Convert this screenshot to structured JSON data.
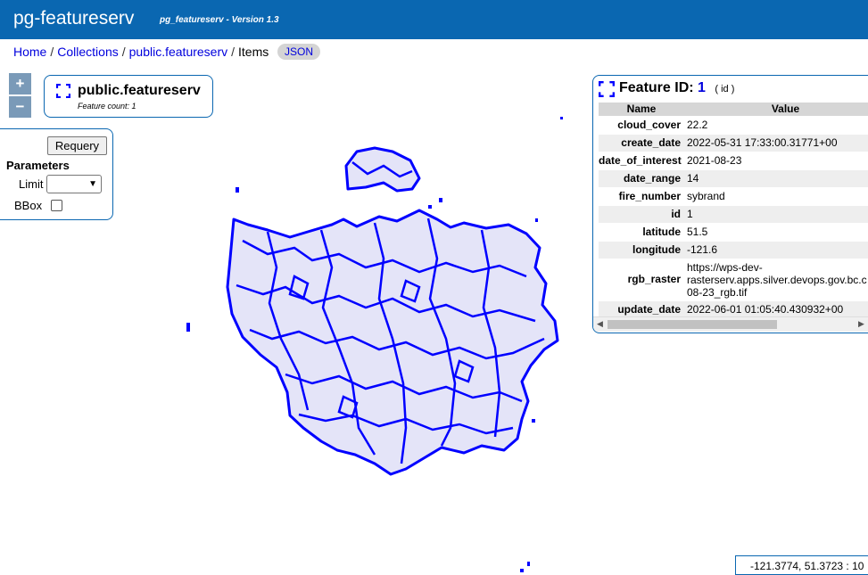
{
  "header": {
    "title": "pg-featureserv",
    "version": "pg_featureserv - Version 1.3"
  },
  "breadcrumb": {
    "home": "Home",
    "collections": "Collections",
    "collection": "public.featureserv",
    "current": "Items",
    "separator": "/"
  },
  "json_button": "JSON",
  "zoom": {
    "in": "+",
    "out": "−"
  },
  "layer": {
    "title": "public.featureserv",
    "count_text": "Feature count: 1"
  },
  "params": {
    "requery": "Requery",
    "title": "Parameters",
    "limit_label": "Limit",
    "limit_value": "",
    "bbox_label": "BBox",
    "bbox_checked": false
  },
  "feature": {
    "label": "Feature ID:",
    "id": "1",
    "id_tag": "( id )",
    "col_name": "Name",
    "col_value": "Value",
    "properties": [
      {
        "name": "cloud_cover",
        "value": "22.2"
      },
      {
        "name": "create_date",
        "value": "2022-05-31 17:33:00.31771+00"
      },
      {
        "name": "date_of_interest",
        "value": "2021-08-23"
      },
      {
        "name": "date_range",
        "value": "14"
      },
      {
        "name": "fire_number",
        "value": "sybrand"
      },
      {
        "name": "id",
        "value": "1"
      },
      {
        "name": "latitude",
        "value": "51.5"
      },
      {
        "name": "longitude",
        "value": "-121.6"
      },
      {
        "name": "rgb_raster",
        "value_lines": [
          "https://wps-dev-",
          "rasterserv.apps.silver.devops.gov.bc.c",
          "08-23_rgb.tif"
        ]
      },
      {
        "name": "update_date",
        "value": "2022-06-01 01:05:40.430932+00"
      }
    ]
  },
  "coordinates": "-121.3774, 51.3723 : 10",
  "colors": {
    "header": "#0a67b1",
    "feature_stroke": "#0000ff",
    "feature_fill": "#e4e4f8",
    "link": "#0000dd"
  },
  "icons": {
    "zoom_in": "plus-icon",
    "zoom_out": "minus-icon",
    "layer": "bracket-frame-icon"
  }
}
